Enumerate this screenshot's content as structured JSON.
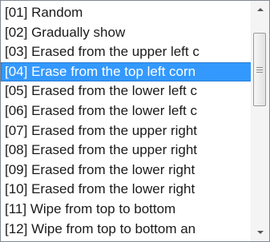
{
  "listbox": {
    "selected_index": 3,
    "items": [
      "[01] Random",
      "[02] Gradually show",
      "[03] Erased from the upper left c",
      "[04] Erase from the top left corn",
      "[05] Erased from the lower left c",
      "[06] Erased from the lower left c",
      "[07] Erased from the upper right",
      "[08] Erased from the upper right",
      "[09] Erased from the lower right",
      "[10] Erased from the lower right",
      "[11] Wipe from top to bottom",
      "[12] Wipe from top to bottom an"
    ]
  },
  "scrollbar": {
    "up_icon": "arrow-up-icon",
    "down_icon": "arrow-down-icon",
    "thumb_icon": "grip-icon"
  },
  "colors": {
    "selection": "#3399ff",
    "selection_text": "#ffffff",
    "text": "#1a1a1a",
    "border": "#828790"
  }
}
